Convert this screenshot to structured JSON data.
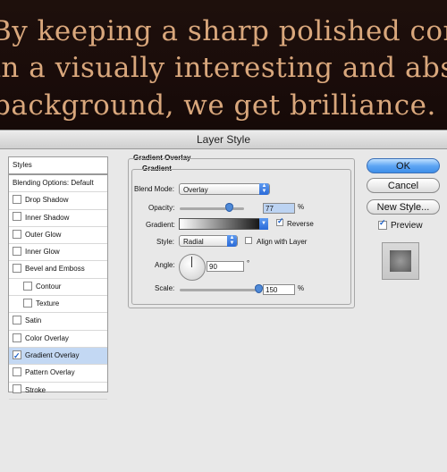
{
  "background_text": {
    "line1": "By keeping a sharp polished content",
    "line2": "in a visually interesting and abstract",
    "line3": "background, we get brilliance."
  },
  "dialog": {
    "title": "Layer Style"
  },
  "left_panel": {
    "header": "Styles",
    "items": [
      {
        "label": "Blending Options: Default",
        "checkbox": false,
        "checked": false,
        "indent": false,
        "selected": false
      },
      {
        "label": "Drop Shadow",
        "checkbox": true,
        "checked": false,
        "indent": false,
        "selected": false
      },
      {
        "label": "Inner Shadow",
        "checkbox": true,
        "checked": false,
        "indent": false,
        "selected": false
      },
      {
        "label": "Outer Glow",
        "checkbox": true,
        "checked": false,
        "indent": false,
        "selected": false
      },
      {
        "label": "Inner Glow",
        "checkbox": true,
        "checked": false,
        "indent": false,
        "selected": false
      },
      {
        "label": "Bevel and Emboss",
        "checkbox": true,
        "checked": false,
        "indent": false,
        "selected": false
      },
      {
        "label": "Contour",
        "checkbox": true,
        "checked": false,
        "indent": true,
        "selected": false
      },
      {
        "label": "Texture",
        "checkbox": true,
        "checked": false,
        "indent": true,
        "selected": false
      },
      {
        "label": "Satin",
        "checkbox": true,
        "checked": false,
        "indent": false,
        "selected": false
      },
      {
        "label": "Color Overlay",
        "checkbox": true,
        "checked": false,
        "indent": false,
        "selected": false
      },
      {
        "label": "Gradient Overlay",
        "checkbox": true,
        "checked": true,
        "indent": false,
        "selected": true
      },
      {
        "label": "Pattern Overlay",
        "checkbox": true,
        "checked": false,
        "indent": false,
        "selected": false
      },
      {
        "label": "Stroke",
        "checkbox": true,
        "checked": false,
        "indent": false,
        "selected": false
      }
    ]
  },
  "gradient_overlay": {
    "section_title": "Gradient Overlay",
    "group_title": "Gradient",
    "blend_mode_label": "Blend Mode:",
    "blend_mode_value": "Overlay",
    "opacity_label": "Opacity:",
    "opacity_value": "77",
    "opacity_unit": "%",
    "opacity_level": 0.77,
    "gradient_label": "Gradient:",
    "reverse_label": "Reverse",
    "reverse_checked": true,
    "style_label": "Style:",
    "style_value": "Radial",
    "align_label": "Align with Layer",
    "align_checked": false,
    "angle_label": "Angle:",
    "angle_value": "90",
    "angle_unit": "°",
    "scale_label": "Scale:",
    "scale_value": "150",
    "scale_unit": "%",
    "scale_level": 1.0
  },
  "buttons": {
    "ok": "OK",
    "cancel": "Cancel",
    "new_style": "New Style...",
    "preview_label": "Preview",
    "preview_checked": true
  },
  "icons": {
    "checkbox_checked": "check-icon",
    "dropdown": "chevron-updown-icon"
  },
  "colors": {
    "hero_text": "#d9a77c",
    "hero_bg": "#1b0f0c",
    "selection": "#c3d8f3",
    "accent": "#3e8ee8"
  }
}
